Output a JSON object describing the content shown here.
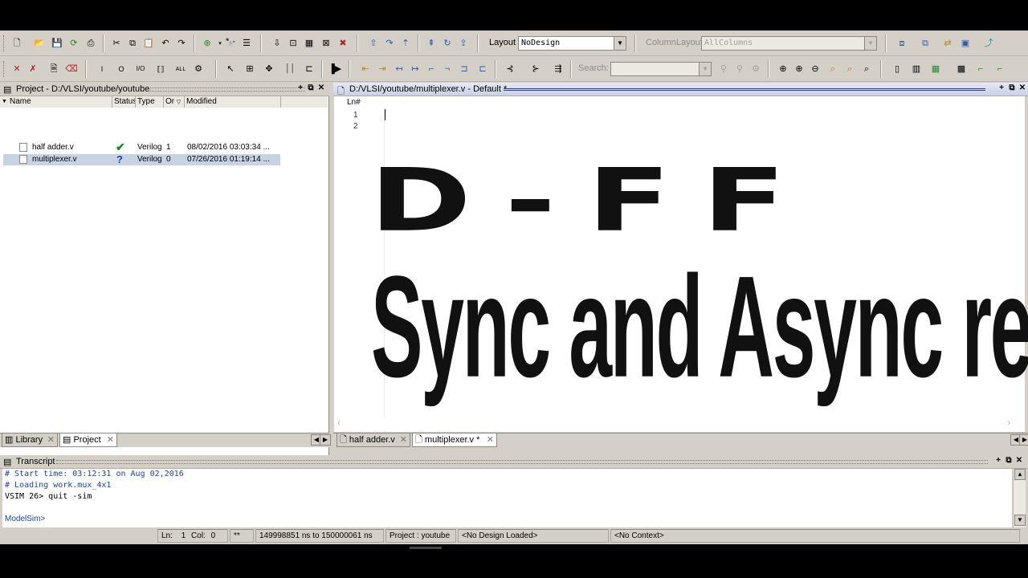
{
  "toolbar1": {
    "icons": [
      "new-icon",
      "open-icon",
      "save-icon",
      "refresh-icon",
      "print-icon",
      "cut-icon",
      "copy-icon",
      "paste-icon",
      "undo-icon",
      "redo-icon",
      "add-icon",
      "find-icon",
      "compile-icon",
      "simulate-icon",
      "help-icon",
      "check-icon",
      "break-icon",
      "close-icon"
    ],
    "layout_label": "Layout",
    "layout_value": "NoDesign",
    "column_layout_label": "ColumnLayout",
    "column_layout_value": "AllColumns"
  },
  "toolbar2": {
    "search_label": "Search:",
    "search_value": ""
  },
  "project_panel": {
    "title": "Project - D:/VLSI/youtube/youtube",
    "columns": [
      "Name",
      "Status",
      "Type",
      "Or",
      "Modified"
    ],
    "rows": [
      {
        "name": "half adder.v",
        "status": "✔",
        "type": "Verilog",
        "order": "1",
        "modified": "08/02/2016 03:03:34 ..."
      },
      {
        "name": "multiplexer.v",
        "status": "?",
        "type": "Verilog",
        "order": "0",
        "modified": "07/26/2016 01:19:14 ..."
      }
    ],
    "tabs": [
      "Library",
      "Project"
    ]
  },
  "editor": {
    "title": "D:/VLSI/youtube/multiplexer.v - Default *",
    "ln_header": "Ln#",
    "line_numbers": [
      "1",
      "2"
    ],
    "overlay_line1": "D-FF",
    "overlay_line2": "Sync and Async reset",
    "tabs": [
      "half adder.v",
      "multiplexer.v *"
    ]
  },
  "transcript": {
    "title": "Transcript",
    "lines": [
      "# Start time: 03:12:31 on Aug 02,2016",
      "# Loading work.mux_4x1",
      "VSIM 26> quit -sim",
      "",
      "ModelSim>"
    ]
  },
  "statusbar": {
    "ln": "Ln:",
    "ln_value": "1",
    "col": "Col:",
    "col_value": "0",
    "stars": "**",
    "time_range": "149998851 ns to 150000061 ns",
    "project": "Project : youtube",
    "design": "<No Design Loaded>",
    "context": "<No Context>"
  },
  "colors": {
    "accent_blue": "#1a3fb0",
    "check_green": "#1a8a1a",
    "selection": "#c7d3e3"
  }
}
